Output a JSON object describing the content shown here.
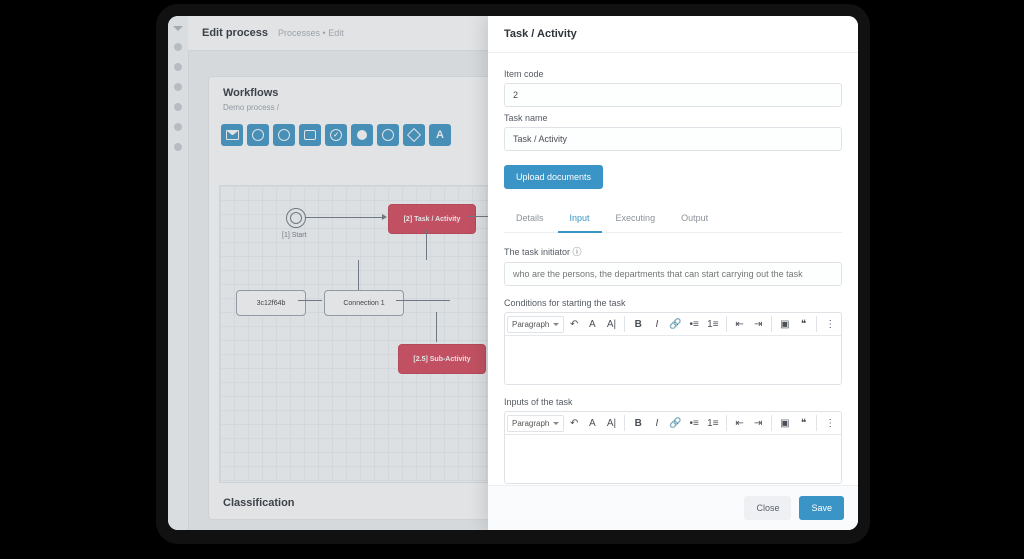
{
  "header": {
    "title": "Edit process",
    "breadcrumb": "Processes  •  Edit"
  },
  "workflows": {
    "title": "Workflows",
    "subtitle": "Demo process /"
  },
  "toolbar_icons": [
    "envelope",
    "clock",
    "timer",
    "rect",
    "check",
    "filled-circle",
    "circle",
    "diamond",
    "letter-A"
  ],
  "nodes": {
    "start_label": "[1] Start",
    "task": "[2] Task / Activity",
    "box1": "3c12f64b",
    "conn": "Connection 1",
    "sub": "[2.5] Sub-Activity"
  },
  "classification": "Classification",
  "panel": {
    "title": "Task / Activity",
    "item_code_label": "Item code",
    "item_code_value": "2",
    "task_name_label": "Task name",
    "task_name_value": "Task / Activity",
    "upload_btn": "Upload documents",
    "tabs": {
      "details": "Details",
      "input": "Input",
      "executing": "Executing",
      "output": "Output"
    },
    "initiator_label": "The task initiator ⓘ",
    "initiator_placeholder": "who are the persons, the departments that can start carrying out the task",
    "conditions_label": "Conditions for starting the task",
    "inputs_label": "Inputs of the task",
    "editor": {
      "paragraph": "Paragraph"
    },
    "close": "Close",
    "save": "Save"
  }
}
